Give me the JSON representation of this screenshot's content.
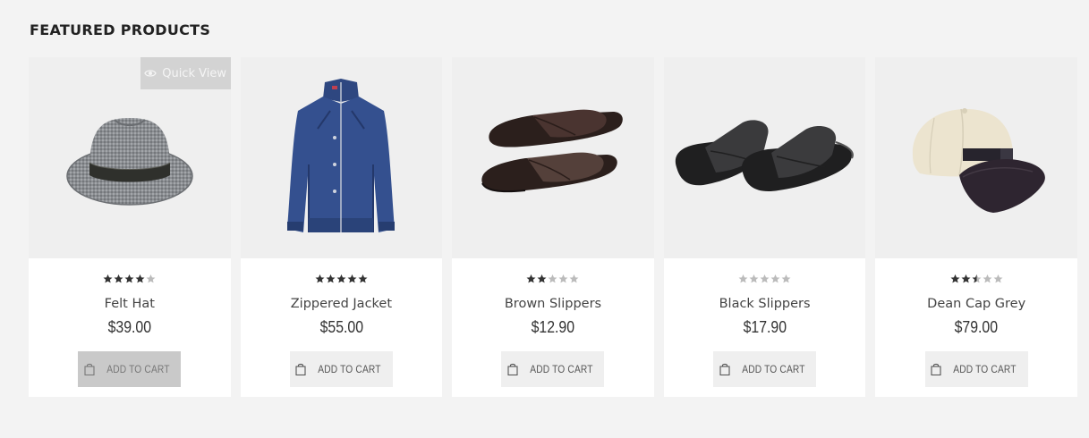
{
  "section": {
    "title": "FEATURED PRODUCTS"
  },
  "quick_view": {
    "label": "Quick View",
    "icon": "eye-icon"
  },
  "colors": {
    "accent": "#333333",
    "thumb_bg": "#efefef",
    "button_bg": "#efefef",
    "button_active_bg": "#c9c9c9",
    "star_filled": "#333333",
    "star_empty": "#bbbbbb"
  },
  "products": [
    {
      "name": "Felt Hat",
      "price": "$39.00",
      "rating": 4,
      "cart_label": "ADD TO CART",
      "image": "felt-hat"
    },
    {
      "name": "Zippered Jacket",
      "price": "$55.00",
      "rating": 5,
      "cart_label": "ADD TO CART",
      "image": "zippered-jacket"
    },
    {
      "name": "Brown Slippers",
      "price": "$12.90",
      "rating": 2,
      "cart_label": "ADD TO CART",
      "image": "brown-slippers"
    },
    {
      "name": "Black Slippers",
      "price": "$17.90",
      "rating": 0,
      "cart_label": "ADD TO CART",
      "image": "black-slippers"
    },
    {
      "name": "Dean Cap Grey",
      "price": "$79.00",
      "rating": 2.5,
      "cart_label": "ADD TO CART",
      "image": "dean-cap"
    }
  ]
}
